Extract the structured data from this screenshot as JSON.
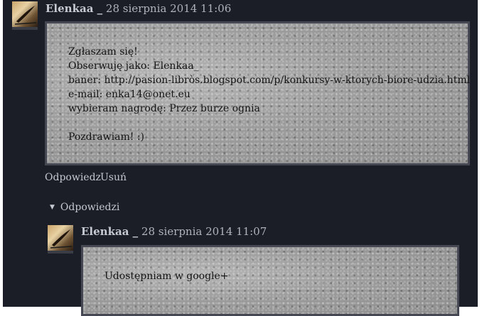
{
  "comments": [
    {
      "author": "Elenkaa _",
      "timestamp": "28 sierpnia 2014 11:06",
      "lines": [
        "Zgłaszam się!",
        "Obserwuję jako: Elenkaa_",
        "baner: http://pasion-libròs.blogspot.com/p/konkursy-w-ktorych-biore-udzia.html",
        "e-mail: enka14@onet.eu",
        "wybieram nagrodę: Przez burze ognia",
        "",
        "Pozdrawiam! :)"
      ],
      "actions": {
        "reply": "Odpowiedz",
        "delete": "Usuń"
      }
    }
  ],
  "replies_toggle": {
    "label": "Odpowiedzi",
    "icon": "caret-down-icon"
  },
  "replies": [
    {
      "author": "Elenkaa _",
      "timestamp": "28 sierpnia 2014 11:07",
      "lines": [
        "Udostępniam w google+"
      ]
    }
  ]
}
